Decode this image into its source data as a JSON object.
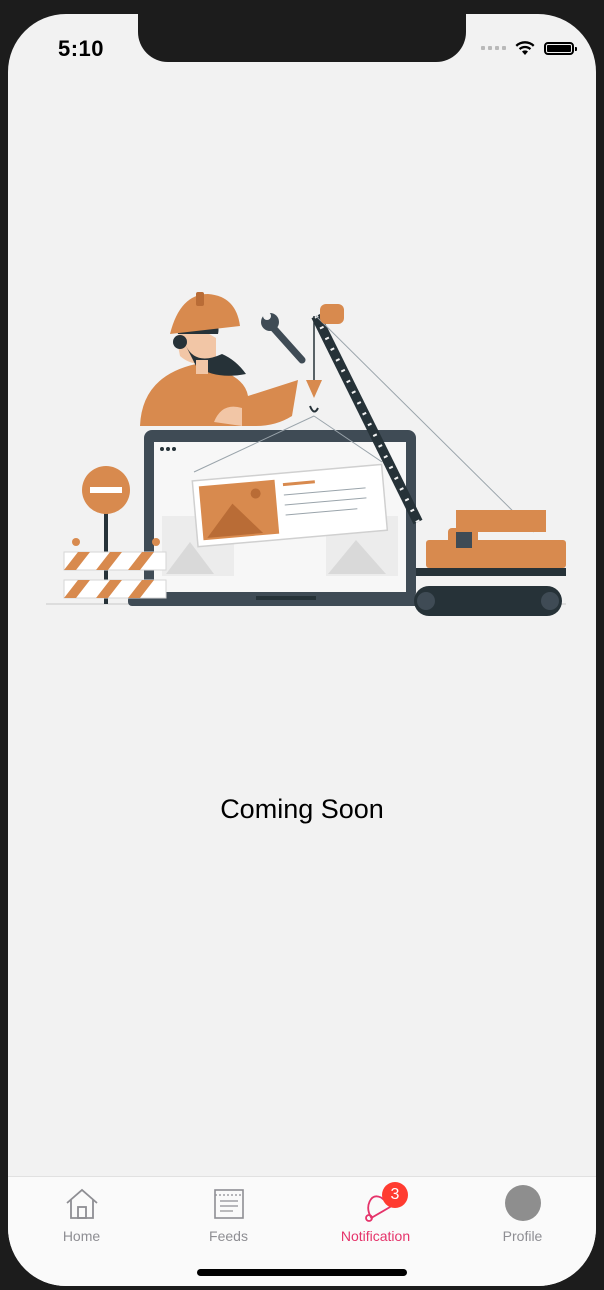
{
  "status_bar": {
    "time": "5:10"
  },
  "content": {
    "message": "Coming Soon"
  },
  "tab_bar": {
    "tabs": [
      {
        "label": "Home",
        "icon": "home-icon",
        "active": false
      },
      {
        "label": "Feeds",
        "icon": "feeds-icon",
        "active": false
      },
      {
        "label": "Notification",
        "icon": "bell-icon",
        "active": true,
        "badge": "3"
      },
      {
        "label": "Profile",
        "icon": "avatar-icon",
        "active": false
      }
    ]
  },
  "colors": {
    "active_tab": "#e5336a",
    "badge": "#ff3b30",
    "illustration_accent": "#d88a4e"
  }
}
